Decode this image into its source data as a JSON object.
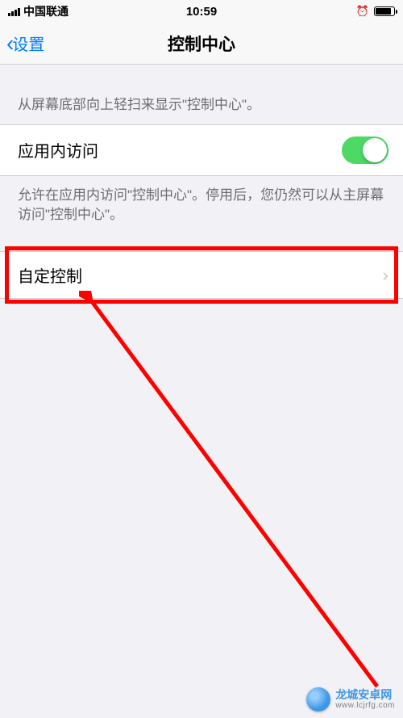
{
  "statusBar": {
    "carrier": "中国联通",
    "time": "10:59"
  },
  "nav": {
    "backLabel": "设置",
    "title": "控制中心"
  },
  "section1": {
    "header": "从屏幕底部向上轻扫来显示\"控制中心\"。"
  },
  "inAppAccess": {
    "label": "应用内访问",
    "footer": "允许在应用内访问\"控制中心\"。停用后，您仍然可以从主屏幕访问\"控制中心\"。"
  },
  "customize": {
    "label": "自定控制"
  },
  "watermark": {
    "name": "龙城安卓网",
    "url": "www.lcjrfg.com"
  },
  "colors": {
    "accent": "#007aff",
    "toggleOn": "#4cd964",
    "highlight": "#ff0000"
  }
}
